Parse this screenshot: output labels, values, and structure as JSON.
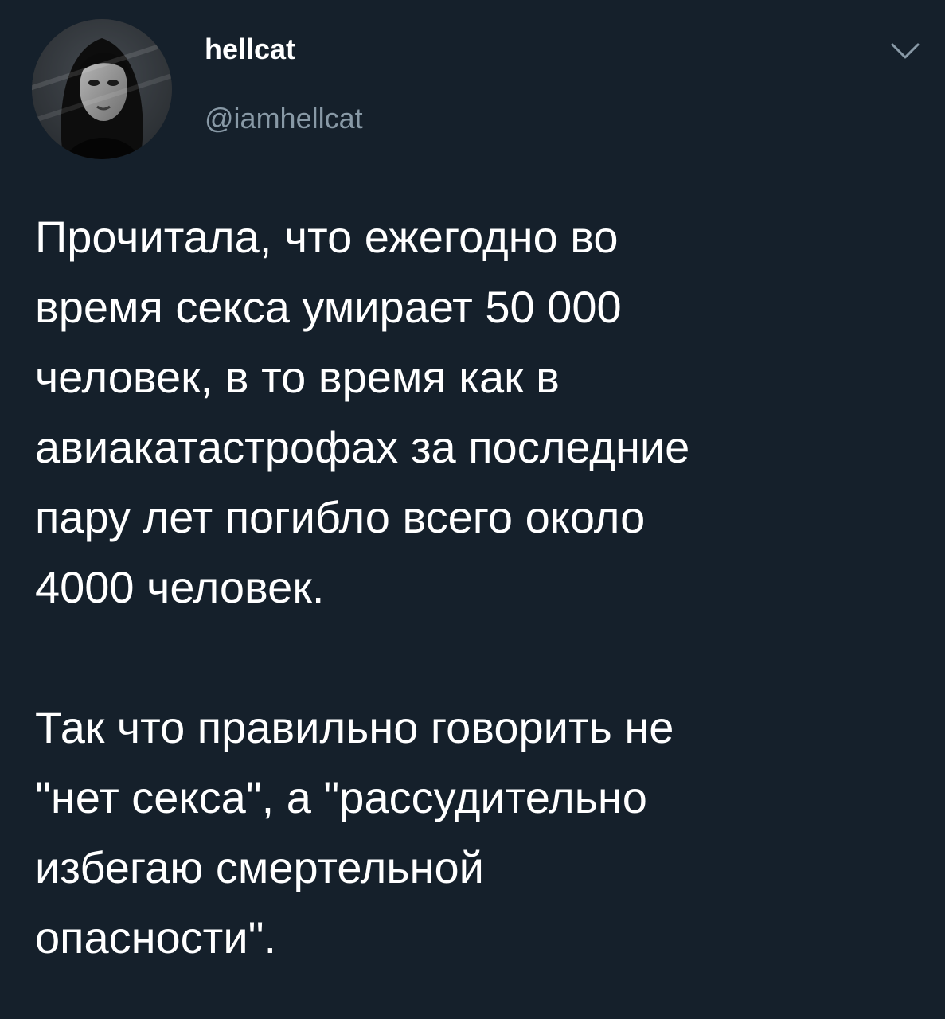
{
  "author": {
    "display_name": "hellcat",
    "handle": "@iamhellcat",
    "avatar_icon": "profile-photo-icon"
  },
  "menu": {
    "icon": "chevron-down-icon"
  },
  "tweet": {
    "paragraphs": [
      {
        "lines": [
          "Прочитала, что ежегодно во",
          "время секса умирает 50 000",
          "человек, в то время как в",
          "авиакатастрофах за последние",
          "пару лет погибло всего около",
          "4000 человек."
        ]
      },
      {
        "lines": [
          "Так что правильно говорить не",
          "\"нет секса\", а \"рассудительно",
          "избегаю смертельной",
          "опасности\"."
        ]
      }
    ]
  },
  "colors": {
    "background": "#15202b",
    "primary_text": "#ffffff",
    "secondary_text": "#8899a6"
  }
}
